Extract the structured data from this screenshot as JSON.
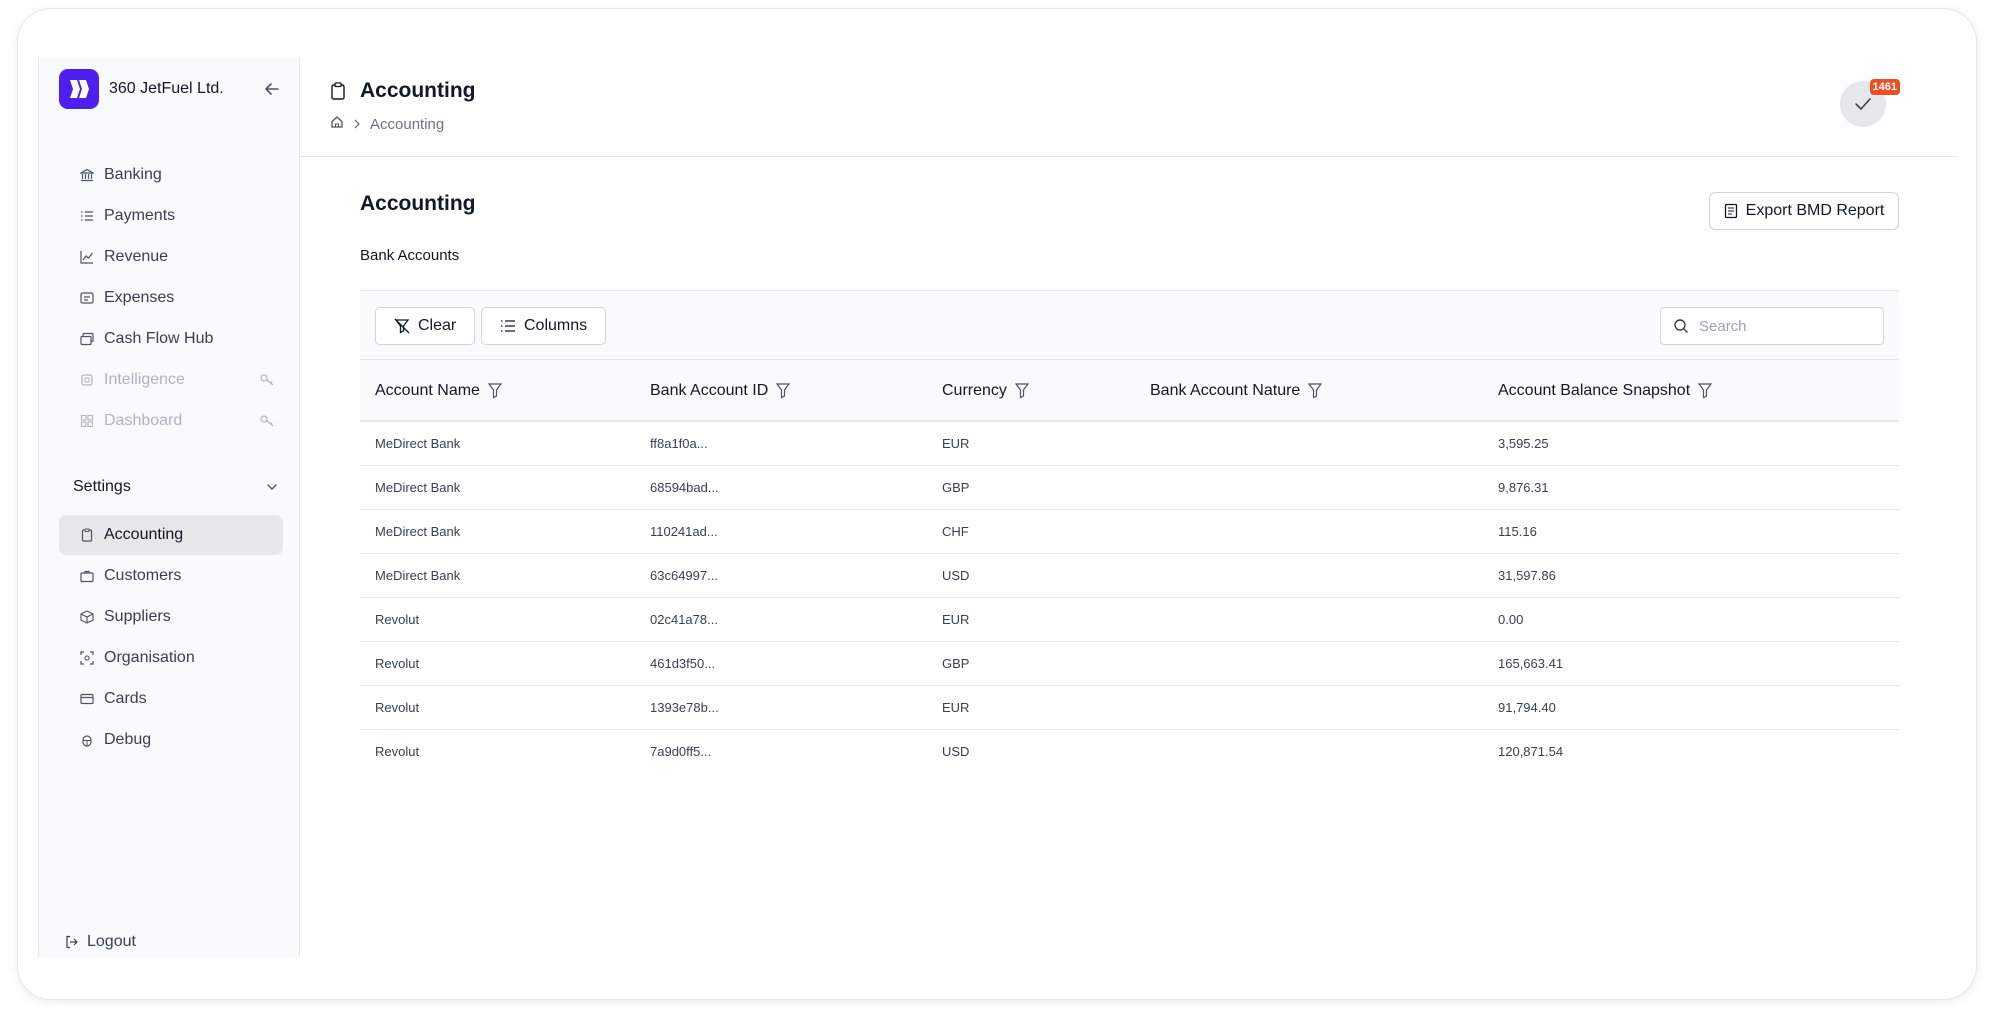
{
  "brand": {
    "name": "360 JetFuel Ltd.",
    "logo_icon": "jetfuel-logo-icon",
    "accent": "#4f1ff0"
  },
  "sidebar": {
    "items": [
      {
        "label": "Banking",
        "icon": "bank-icon",
        "disabled": false
      },
      {
        "label": "Payments",
        "icon": "list-icon",
        "disabled": false
      },
      {
        "label": "Revenue",
        "icon": "chart-line-icon",
        "disabled": false
      },
      {
        "label": "Expenses",
        "icon": "receipt-icon",
        "disabled": false
      },
      {
        "label": "Cash Flow Hub",
        "icon": "cash-stack-icon",
        "disabled": false
      },
      {
        "label": "Intelligence",
        "icon": "brain-icon",
        "disabled": true
      },
      {
        "label": "Dashboard",
        "icon": "grid-icon",
        "disabled": true
      }
    ],
    "settings_label": "Settings",
    "settings_items": [
      {
        "label": "Accounting",
        "icon": "clipboard-icon",
        "active": true
      },
      {
        "label": "Customers",
        "icon": "briefcase-icon",
        "active": false
      },
      {
        "label": "Suppliers",
        "icon": "package-icon",
        "active": false
      },
      {
        "label": "Organisation",
        "icon": "scan-icon",
        "active": false
      },
      {
        "label": "Cards",
        "icon": "credit-card-icon",
        "active": false
      },
      {
        "label": "Debug",
        "icon": "bug-icon",
        "active": false
      }
    ],
    "logout_label": "Logout"
  },
  "header": {
    "title": "Accounting",
    "breadcrumb": [
      "Accounting"
    ],
    "notification_count": "1461",
    "badge_color": "#f04d23"
  },
  "main": {
    "title": "Accounting",
    "export_label": "Export BMD Report",
    "section_title": "Bank Accounts",
    "toolbar": {
      "clear_label": "Clear",
      "columns_label": "Columns",
      "search_placeholder": "Search"
    },
    "columns": [
      "Account Name",
      "Bank Account ID",
      "Currency",
      "Bank Account Nature",
      "Account Balance Snapshot"
    ],
    "rows": [
      [
        "MeDirect Bank",
        "ff8a1f0a...",
        "EUR",
        "",
        "3,595.25"
      ],
      [
        "MeDirect Bank",
        "68594bad...",
        "GBP",
        "",
        "9,876.31"
      ],
      [
        "MeDirect Bank",
        "110241ad...",
        "CHF",
        "",
        "115.16"
      ],
      [
        "MeDirect Bank",
        "63c64997...",
        "USD",
        "",
        "31,597.86"
      ],
      [
        "Revolut",
        "02c41a78...",
        "EUR",
        "",
        "0.00"
      ],
      [
        "Revolut",
        "461d3f50...",
        "GBP",
        "",
        "165,663.41"
      ],
      [
        "Revolut",
        "1393e78b...",
        "EUR",
        "",
        "91,794.40"
      ],
      [
        "Revolut",
        "7a9d0ff5...",
        "USD",
        "",
        "120,871.54"
      ]
    ]
  }
}
